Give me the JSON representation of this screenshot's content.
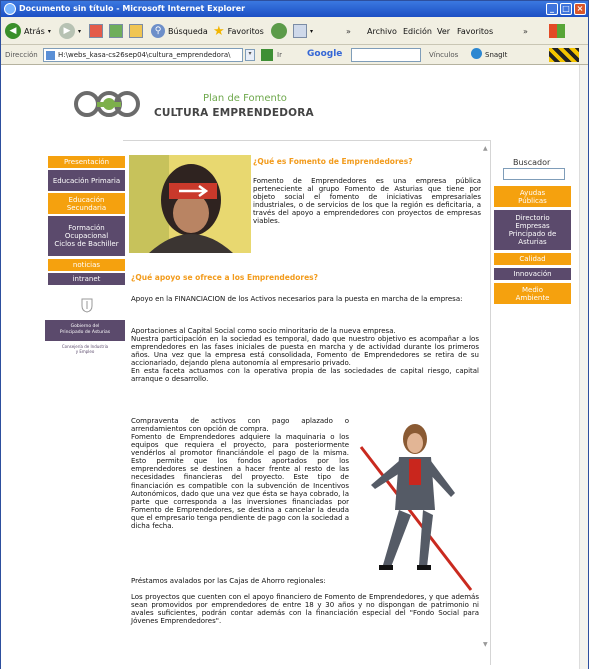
{
  "window": {
    "title": "Documento sin título - Microsoft Internet Explorer"
  },
  "toolbar": {
    "back": "Atrás",
    "search": "Búsqueda",
    "favorites": "Favoritos",
    "menu_file": "Archivo",
    "menu_edit": "Edición",
    "menu_view": "Ver",
    "menu_favorites": "Favoritos"
  },
  "addressbar": {
    "label": "Dirección",
    "url": "H:\\webs_kasa-cs26sep04\\cultura_emprendedora\\",
    "go": "Ir",
    "google": "Google",
    "vinculos": "Vínculos",
    "snagit": "SnagIt"
  },
  "header": {
    "plan": "Plan de Fomento",
    "brand": "CULTURA EMPRENDEDORA",
    "colors": {
      "orange": "#f5a10e",
      "purple": "#5b4a6c",
      "plan_green": "#6ea84c"
    }
  },
  "left_nav": [
    {
      "label": "Presentación",
      "style": "orange"
    },
    {
      "label": "Educación Primaria",
      "style": "purple"
    },
    {
      "label": "Educación Secundaria",
      "style": "orange"
    },
    {
      "label": "Formación Ocupacional Ciclos de Bachiller",
      "style": "purple"
    },
    {
      "label": "noticias",
      "style": "orange"
    },
    {
      "label": "intranet",
      "style": "purple"
    }
  ],
  "gobierno": {
    "line1": "Gobierno del",
    "line2": "Principado de Asturias",
    "line3": "Consejería de Industria",
    "line4": "y Empleo"
  },
  "right_nav": {
    "search_label": "Buscador",
    "items": [
      {
        "label": "Ayudas Públicas",
        "style": "orange"
      },
      {
        "label": "Directorio Empresas Principado de Asturias",
        "style": "purple"
      },
      {
        "label": "Calidad",
        "style": "orange"
      },
      {
        "label": "Innovación",
        "style": "purple"
      },
      {
        "label": "Medio Ambiente",
        "style": "orange"
      }
    ]
  },
  "content": {
    "q1": "¿Qué es Fomento de Emprendedores?",
    "p1": "Fomento de Emprendedores es una empresa pública perteneciente al grupo Fomento de Asturias que tiene por objeto social el fomento de iniciativas empresariales industriales, o de servicios de los que la región es deficitaria, a través del apoyo a emprendedores con proyectos de empresas viables.",
    "q2": "¿Qué apoyo se ofrece a los Emprendedores?",
    "p2": "Apoyo en la FINANCIACION de los Activos necesarios para la puesta en marcha de la empresa:",
    "p3": "Aportaciones al Capital Social como socio minoritario de la nueva empresa.",
    "p4": "Nuestra participación en la sociedad es temporal, dado que nuestro objetivo es acompañar a los emprendedores en las fases iniciales de puesta en marcha y de actividad durante los primeros años. Una vez que la empresa está consolidada, Fomento de Emprendedores se retira de su accionariado, dejando plena autonomía al empresario privado.",
    "p5": "En esta faceta actuamos con la operativa propia de las sociedades de capital riesgo, capital arranque o desarrollo.",
    "p6": "Compraventa de activos con pago aplazado o arrendamientos con opción de compra.",
    "p7": "Fomento de Emprendedores adquiere la maquinaria o los equipos que requiera el proyecto, para posteriormente vendérlos al promotor financiándole el pago de la misma. Esto permite que los fondos aportados por los emprendedores se destinen a hacer frente al resto de las necesidades financieras del proyecto. Este tipo de financiación es compatible con la subvención de Incentivos Autonómicos, dado que una vez que ésta se haya cobrado, la parte que corresponda a las inversiones financiadas por Fomento de Emprendedores, se destina a cancelar la deuda que el empresario tenga pendiente de pago con la sociedad a dicha fecha.",
    "p8": "Préstamos avalados por las Cajas de Ahorro regionales:",
    "p9": "Los proyectos que cuenten con el apoyo financiero de Fomento de Emprendedores, y que además sean promovidos por emprendedores de entre 18 y 30 años y no dispongan de patrimonio ni avales suficientes, podrán contar además con la financiación especial del \"Fondo Social para Jóvenes Emprendedores\"."
  }
}
